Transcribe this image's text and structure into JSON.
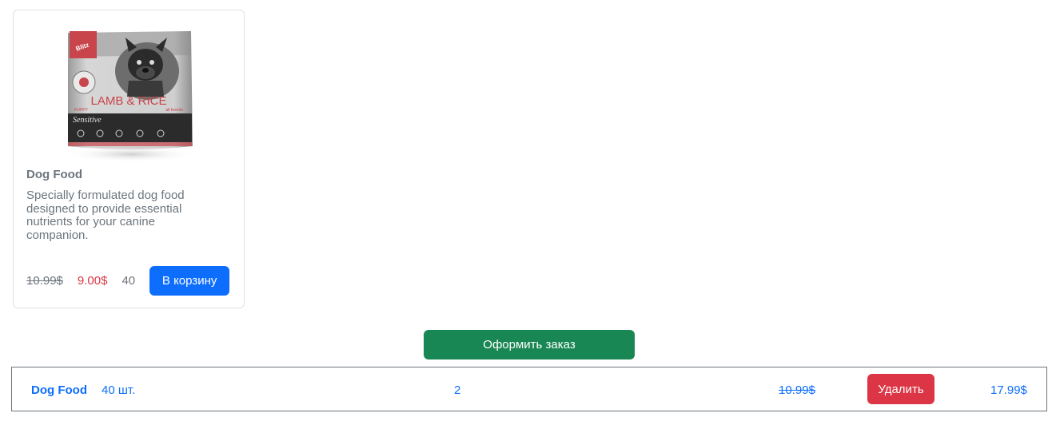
{
  "product": {
    "title": "Dog Food",
    "description": "Specially formulated dog food designed to provide essential nutrients for your canine companion.",
    "old_price": "10.99$",
    "price": "9.00$",
    "stock": "40",
    "cart_button_label": "В корзину",
    "image": {
      "brand": "Blitz",
      "headline": "LAMB & RICE",
      "subline": "PUPPY",
      "subline_right": "all breeds",
      "variant": "Sensitive"
    }
  },
  "checkout": {
    "button_label": "Оформить заказ"
  },
  "cart": {
    "items": [
      {
        "name": "Dog Food",
        "stock": "40 шт.",
        "count": "2",
        "old_price": "10.99$",
        "delete_label": "Удалить",
        "total": "17.99$"
      }
    ]
  },
  "colors": {
    "primary": "#0d6efd",
    "success": "#198754",
    "danger": "#dc3545",
    "muted": "#6c757d"
  }
}
